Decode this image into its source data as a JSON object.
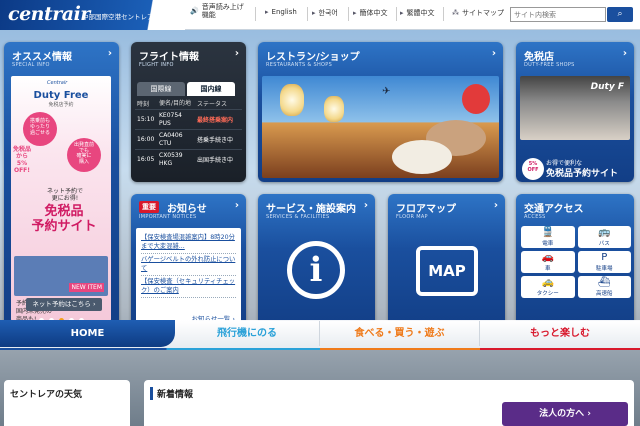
{
  "header": {
    "logo": "centrair",
    "logo_sub": "中部国際空港セントレア",
    "links": [
      {
        "label": "音声読み上げ\n機能",
        "icon": "speaker-icon"
      },
      {
        "label": "English",
        "icon": "arrow-icon"
      },
      {
        "label": "한국어",
        "icon": "arrow-icon"
      },
      {
        "label": "簡体中文",
        "icon": "arrow-icon"
      },
      {
        "label": "繁體中文",
        "icon": "arrow-icon"
      },
      {
        "label": "サイトマップ",
        "icon": "sitemap-icon"
      }
    ],
    "search_placeholder": "サイト内検索"
  },
  "tiles": {
    "special": {
      "title": "オススメ情報",
      "sub": "SPECIAL INFO",
      "brand_top": "Centrair",
      "brand": "Duty Free",
      "brand_sub": "免税店予約",
      "c1": "搭乗前も\nゆったり\n過ごせる",
      "c2": "出発直前\nでも\n確実に\n購入",
      "pct": "免税品\nから\n5%\nOFF!",
      "promo": "ネット予約で\n更にお得!",
      "big": "免税品\n予約サイト",
      "mini": "NEW ITEM",
      "foot": "予約搭乗品や\n国内未発売の\n商品も!",
      "btn": "ネット予約はこちら ›"
    },
    "flight": {
      "title": "フライト情報",
      "sub": "FLIGHT INFO",
      "tab_intl": "国際線",
      "tab_dom": "国内線",
      "headers": [
        "時刻",
        "便名/目的地",
        "ステータス"
      ],
      "rows": [
        {
          "time": "15:10",
          "flight": "KE0754\nPUS",
          "status": "最終搭乗案内"
        },
        {
          "time": "16:00",
          "flight": "CA0406\nCTU",
          "status": "搭乗手続き中"
        },
        {
          "time": "16:05",
          "flight": "CX0539\nHKG",
          "status": "出国手続き中"
        }
      ]
    },
    "restaurant": {
      "title": "レストラン/ショップ",
      "sub": "RESTAURANTS & SHOPS"
    },
    "dutyfree": {
      "title": "免税店",
      "sub": "DUTY-FREE SHOPS",
      "sign": "Duty F",
      "badge": "5%\nOFF",
      "t1": "お得で便利な",
      "t2": "免税品予約サイト"
    },
    "notices": {
      "badge": "重要",
      "title": "お知らせ",
      "sub": "IMPORTANT NOTICES",
      "items": [
        "【保安検査場混雑案内】8時20分まで大変混雑...",
        "バゲージベルトの外れ防止について",
        "【保安検査（セキュリティチェック）のご案内"
      ],
      "more": "お知らせ一覧 ›"
    },
    "service": {
      "title": "サービス・施設案内",
      "sub": "SERVICES & FACILITIES",
      "glyph": "i"
    },
    "floor": {
      "title": "フロアマップ",
      "sub": "FLOOR MAP",
      "glyph": "MAP"
    },
    "access": {
      "title": "交通アクセス",
      "sub": "ACCESS",
      "items": [
        {
          "label": "電車",
          "icon": "train-icon",
          "g": "🚆"
        },
        {
          "label": "バス",
          "icon": "bus-icon",
          "g": "🚌"
        },
        {
          "label": "車",
          "icon": "car-icon",
          "g": "🚗"
        },
        {
          "label": "駐車場",
          "icon": "parking-icon",
          "g": "P"
        },
        {
          "label": "タクシー",
          "icon": "taxi-icon",
          "g": "🚕"
        },
        {
          "label": "高速船",
          "icon": "ship-icon",
          "g": "⛴"
        }
      ]
    }
  },
  "nav": {
    "home": "HOME",
    "fly": "飛行機にのる",
    "eat": "食べる・買う・遊ぶ",
    "fun": "もっと楽しむ",
    "colors": {
      "home": "#1a4f9e",
      "fly": "#2aa1d8",
      "eat": "#ef7b1c",
      "fun": "#d8192d"
    }
  },
  "bottom": {
    "weather": "セントレアの天気",
    "news": "新着情報",
    "corp": "法人の方へ ›"
  }
}
